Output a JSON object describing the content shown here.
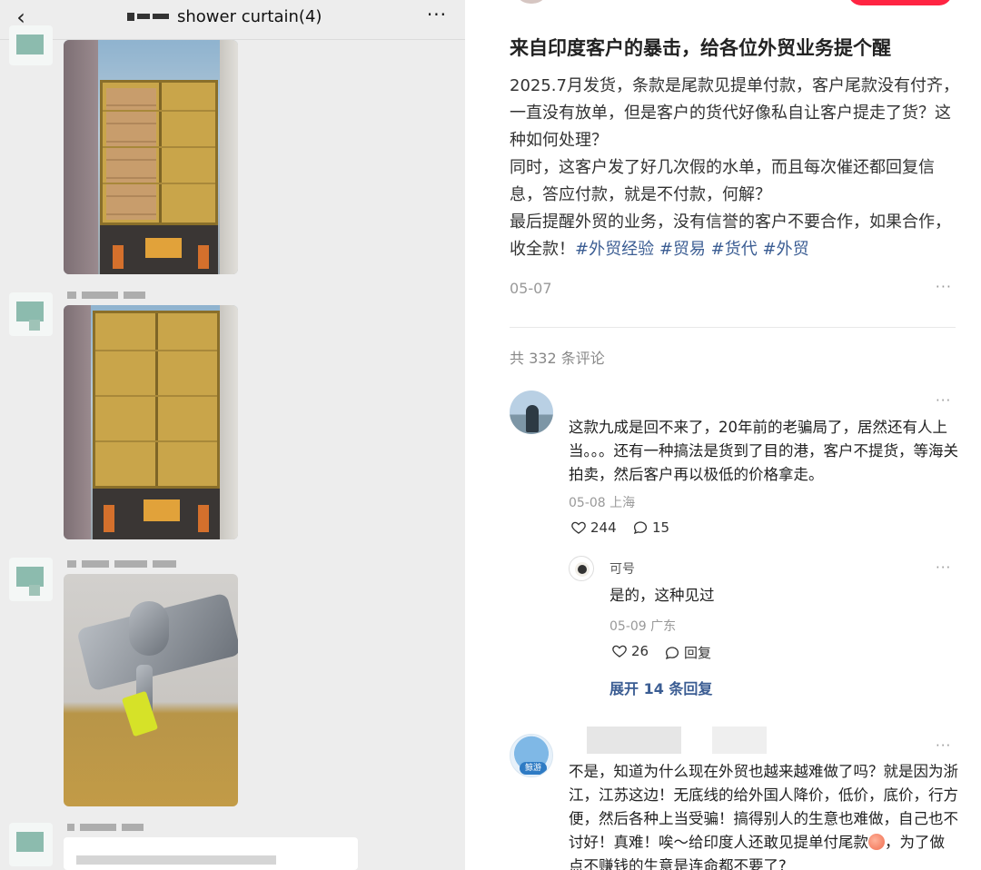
{
  "chat": {
    "back_icon": "chevron-left-icon",
    "title": "shower curtain(4)",
    "more_icon": "more-horizontal-icon",
    "more_label": "···"
  },
  "post": {
    "title": "来自印度客户的暴击，给各位外贸业务提个醒",
    "body": "2025.7月发货，条款是尾款见提单付款，客户尾款没有付齐，一直没有放单，但是客户的货代好像私自让客户提走了货？这种如何处理？\n同时，这客户发了好几次假的水单，而且每次催还都回复信息，答应付款，就是不付款，何解？\n最后提醒外贸的业务，没有信誉的客户不要合作，如果合作，收全款！",
    "tags": [
      "#外贸经验",
      "#贸易",
      "#货代",
      "#外贸"
    ],
    "date": "05-07",
    "more_label": "···",
    "comment_count": "共 332 条评论",
    "accent_color": "#ff2442",
    "tag_color": "#3b5d93"
  },
  "comments": [
    {
      "text": "这款九成是回不来了，20年前的老骗局了，居然还有人上当。。。还有一种搞法是货到了目的港，客户不提货，等海关拍卖，然后客户再以极低的价格拿走。",
      "meta": "05-08 上海",
      "likes": "244",
      "replies": "15",
      "more_label": "···",
      "reply": {
        "author": "可号",
        "text": "是的，这种见过",
        "meta": "05-09 广东",
        "likes": "26",
        "reply_label": "回复",
        "more_label": "···"
      },
      "expand_label": "展开 14 条回复"
    },
    {
      "badge": "鲸游",
      "text_before_emoji": "不是，知道为什么现在外贸也越来越难做了吗？就是因为浙江，江苏这边！无底线的给外国人降价，低价，底价，行方便，然后各种上当受骗！搞得别人的生意也难做，自己也不讨好！真难！唉～给印度人还敢见提单付尾款",
      "text_after_emoji": "，为了做点不赚钱的生意是连命都不要了?",
      "more_label": "···"
    }
  ]
}
